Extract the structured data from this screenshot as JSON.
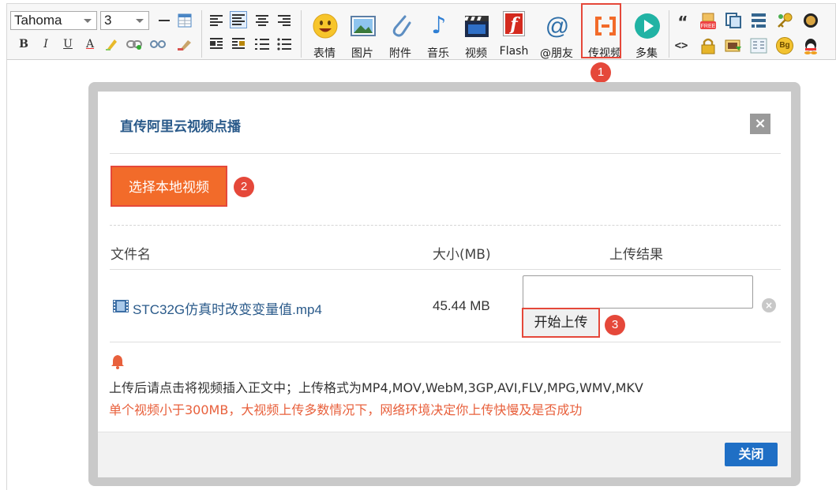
{
  "toolbar": {
    "font_name": "Tahoma",
    "font_size": "3",
    "format_icons": [
      "bold-icon",
      "italic-icon",
      "underline-icon",
      "font-color-icon",
      "highlight-icon",
      "link-icon",
      "unlink-icon",
      "clear-format-icon"
    ],
    "format_glyphs": {
      "bold": "B",
      "italic": "I",
      "underline": "U",
      "font_color": "A"
    },
    "align_icons": [
      "align-left-icon",
      "align-center-active-icon",
      "align-center-icon",
      "align-right-icon",
      "indent-left-icon",
      "indent-right-icon",
      "ordered-list-icon",
      "unordered-list-icon"
    ],
    "buttons": [
      {
        "label": "表情",
        "icon": "emoji-icon"
      },
      {
        "label": "图片",
        "icon": "image-icon"
      },
      {
        "label": "附件",
        "icon": "attachment-icon"
      },
      {
        "label": "音乐",
        "icon": "music-icon"
      },
      {
        "label": "视频",
        "icon": "video-icon"
      },
      {
        "label": "Flash",
        "icon": "flash-icon"
      },
      {
        "label": "@朋友",
        "icon": "at-icon"
      },
      {
        "label": "传视频",
        "icon": "upload-video-icon"
      },
      {
        "label": "多集",
        "icon": "play-icon"
      }
    ],
    "extra_icons": [
      "quote-icon",
      "free-icon",
      "copy-icon",
      "table-icon",
      "key-icon",
      "coin-icon",
      "code-icon",
      "lock-icon",
      "download-icon",
      "columns-icon",
      "bg-icon",
      "qq-icon"
    ],
    "quote_glyph": "“",
    "code_glyph": "<>",
    "bg_glyph": "Bg",
    "free_glyph": "FREE",
    "at_glyph": "@",
    "music_glyph": "♪",
    "flash_glyph": "f"
  },
  "annotations": {
    "badge1": "1",
    "badge2": "2",
    "badge3": "3"
  },
  "modal": {
    "title": "直传阿里云视频点播",
    "close_icon": "×",
    "choose_button": "选择本地视频",
    "table": {
      "headers": {
        "file": "文件名",
        "size": "大小(MB)",
        "result": "上传结果"
      },
      "rows": [
        {
          "file_name": "STC32G仿真时改变变量值.mp4",
          "size": "45.44 MB",
          "upload_button": "开始上传",
          "remove_icon": "×"
        }
      ]
    },
    "note_line1": "上传后请点击将视频插入正文中；上传格式为MP4,MOV,WebM,3GP,AVI,FLV,MPG,WMV,MKV",
    "note_line2": "单个视频小于300MB，大视频上传多数情况下，网络环境决定你上传快慢及是否成功",
    "footer_close": "关闭"
  },
  "colors": {
    "accent_orange": "#f26b2a",
    "highlight_red": "#e5483a",
    "title_blue": "#2a5a8a",
    "primary_blue": "#1f6fc5",
    "warning_text": "#e8603c"
  }
}
